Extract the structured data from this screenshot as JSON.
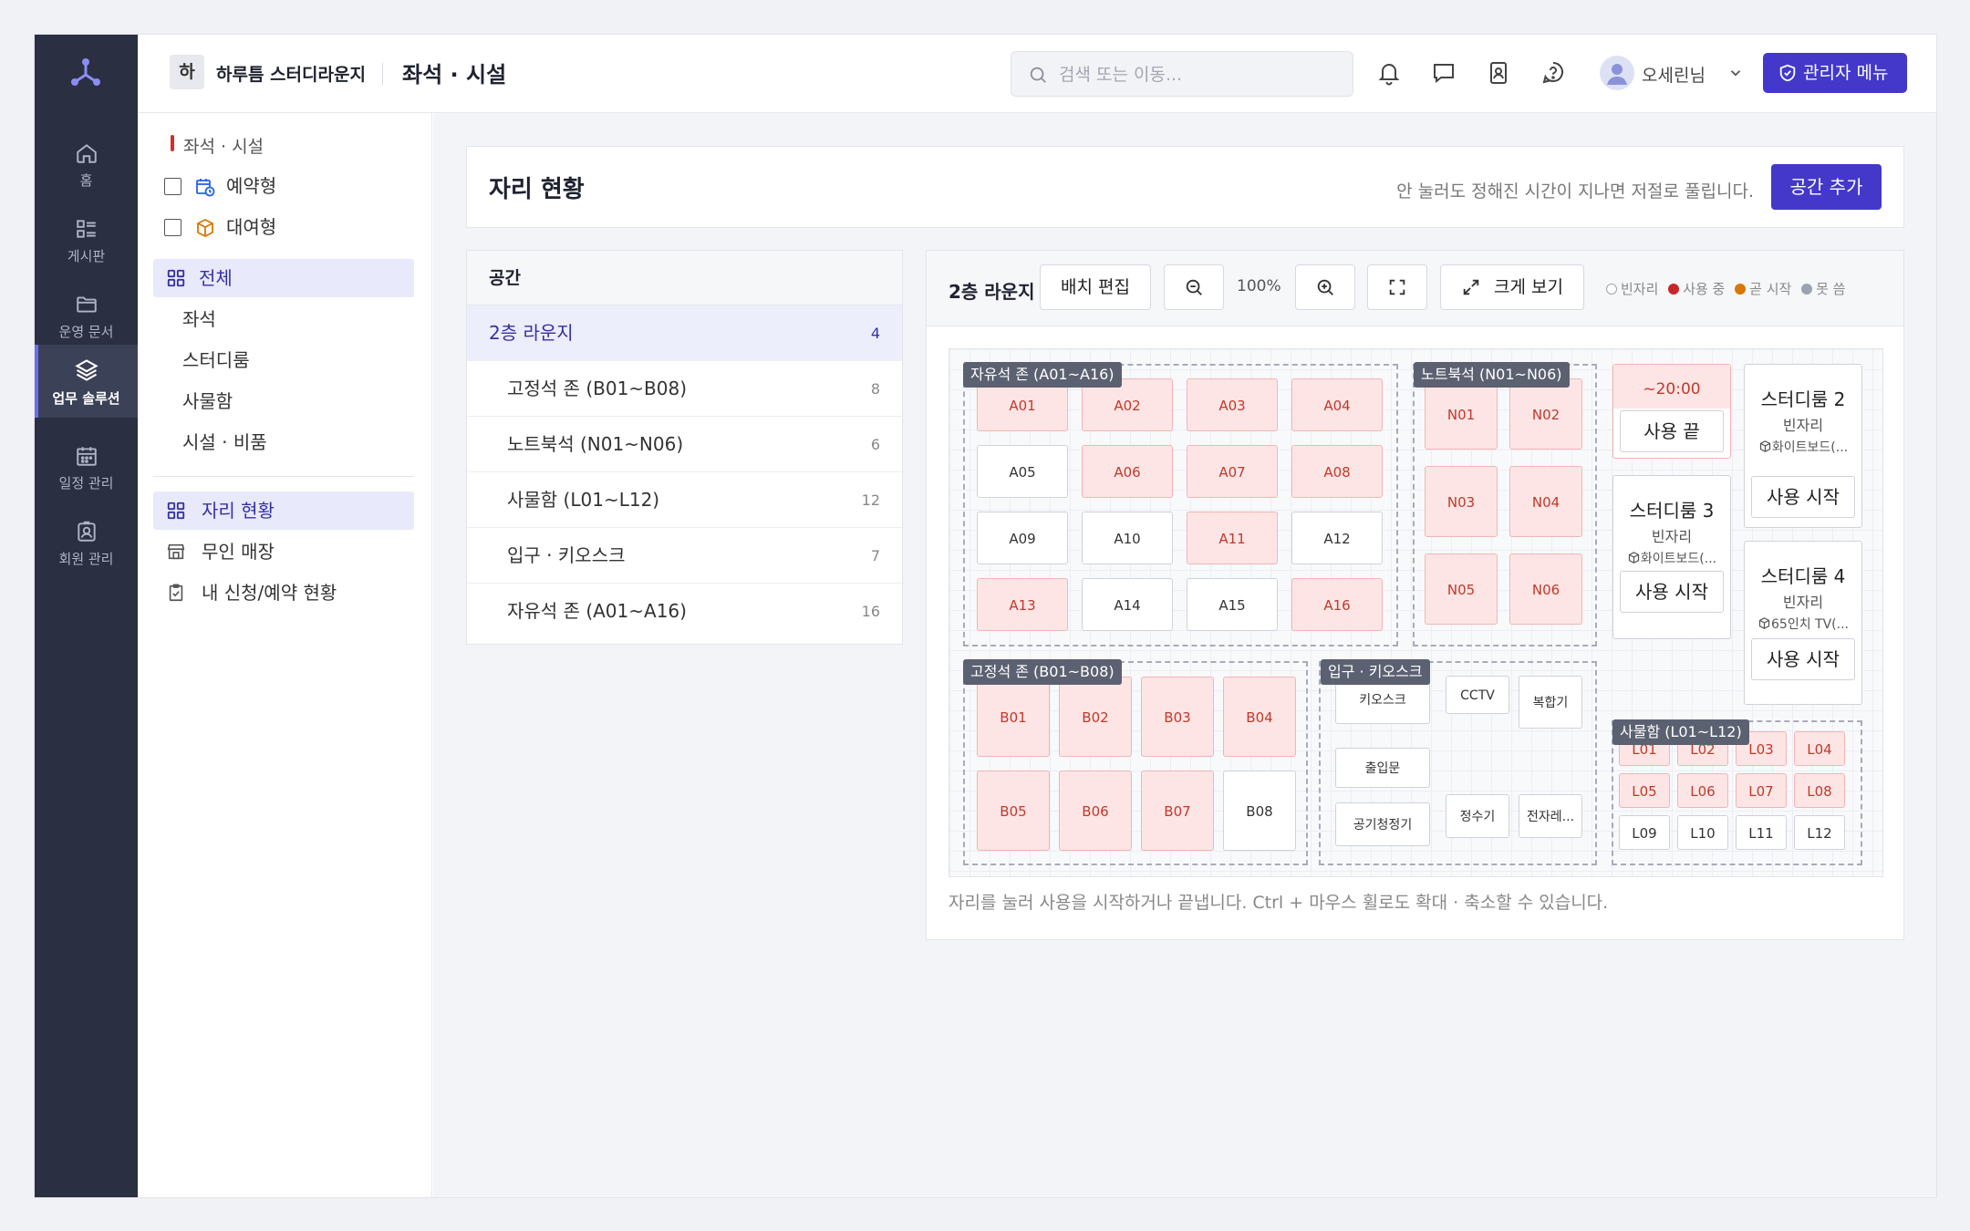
{
  "rail": {
    "items": [
      {
        "label": "홈",
        "icon": "home-icon"
      },
      {
        "label": "게시판",
        "icon": "board-icon"
      },
      {
        "label": "운영 문서",
        "icon": "folder-icon"
      },
      {
        "label": "업무 솔루션",
        "icon": "layers-icon",
        "active": true
      },
      {
        "label": "일정 관리",
        "icon": "calendar-icon"
      },
      {
        "label": "회원 관리",
        "icon": "member-icon"
      }
    ]
  },
  "topbar": {
    "org_badge": "하",
    "org_name": "하루틈 스터디라운지",
    "page_title": "좌석 · 시설",
    "search_placeholder": "검색 또는 이동...",
    "user_name": "오세린님",
    "admin_label": "관리자 메뉴"
  },
  "sidebar": {
    "section": "좌석 · 시설",
    "filters": [
      {
        "label": "예약형",
        "icon": "calendar-clock-icon",
        "checked": false
      },
      {
        "label": "대여형",
        "icon": "box-icon",
        "checked": false
      }
    ],
    "categories": [
      {
        "label": "전체",
        "active": true
      },
      {
        "label": "좌석"
      },
      {
        "label": "스터디룸"
      },
      {
        "label": "사물함"
      },
      {
        "label": "시설 · 비품"
      }
    ],
    "links": [
      {
        "label": "자리 현황",
        "active": true
      },
      {
        "label": "무인 매장"
      },
      {
        "label": "내 신청/예약 현황"
      }
    ]
  },
  "header": {
    "title": "자리 현황",
    "hint": "안 눌러도 정해진 시간이 지나면 저절로 풀립니다.",
    "add_label": "공간 추가"
  },
  "spaces": {
    "title": "공간",
    "rows": [
      {
        "name": "2층 라운지",
        "count": "4",
        "active": true
      },
      {
        "name": "고정석 존 (B01~B08)",
        "count": "8"
      },
      {
        "name": "노트북석 (N01~N06)",
        "count": "6"
      },
      {
        "name": "사물함 (L01~L12)",
        "count": "12"
      },
      {
        "name": "입구 · 키오스크",
        "count": "7"
      },
      {
        "name": "자유석 존 (A01~A16)",
        "count": "16"
      }
    ]
  },
  "map": {
    "title": "2층 라운지",
    "edit_label": "배치 편집",
    "zoom": "100%",
    "expand_label": "크게 보기",
    "legend": [
      {
        "label": "빈자리",
        "color": "#ffffff"
      },
      {
        "label": "사용 중",
        "color": "#c62828"
      },
      {
        "label": "곧 시작",
        "color": "#d97706"
      },
      {
        "label": "못 씀",
        "color": "#9ca3af"
      }
    ],
    "zones": {
      "free": "자유석 존 (A01~A16)",
      "notebook": "노트북석 (N01~N06)",
      "fixed": "고정석 존 (B01~B08)",
      "entrance": "입구 · 키오스크",
      "locker": "사물함 (L01~L12)"
    },
    "free_seats": [
      {
        "id": "A01",
        "busy": true
      },
      {
        "id": "A02",
        "busy": true
      },
      {
        "id": "A03",
        "busy": true
      },
      {
        "id": "A04",
        "busy": true
      },
      {
        "id": "A05",
        "busy": false
      },
      {
        "id": "A06",
        "busy": true
      },
      {
        "id": "A07",
        "busy": true
      },
      {
        "id": "A08",
        "busy": true
      },
      {
        "id": "A09",
        "busy": false
      },
      {
        "id": "A10",
        "busy": false
      },
      {
        "id": "A11",
        "busy": true
      },
      {
        "id": "A12",
        "busy": false
      },
      {
        "id": "A13",
        "busy": true
      },
      {
        "id": "A14",
        "busy": false
      },
      {
        "id": "A15",
        "busy": false
      },
      {
        "id": "A16",
        "busy": true
      }
    ],
    "notebook_seats": [
      {
        "id": "N01",
        "busy": true
      },
      {
        "id": "N02",
        "busy": true
      },
      {
        "id": "N03",
        "busy": true
      },
      {
        "id": "N04",
        "busy": true
      },
      {
        "id": "N05",
        "busy": true
      },
      {
        "id": "N06",
        "busy": true
      }
    ],
    "fixed_seats": [
      {
        "id": "B01",
        "busy": true
      },
      {
        "id": "B02",
        "busy": true
      },
      {
        "id": "B03",
        "busy": true
      },
      {
        "id": "B04",
        "busy": true
      },
      {
        "id": "B05",
        "busy": true
      },
      {
        "id": "B06",
        "busy": true
      },
      {
        "id": "B07",
        "busy": true
      },
      {
        "id": "B08",
        "busy": false
      }
    ],
    "entrance_items": [
      "키오스크",
      "CCTV",
      "복합기",
      "출입문",
      "공기청정기",
      "정수기",
      "전자레..."
    ],
    "lockers": [
      {
        "id": "L01",
        "busy": true
      },
      {
        "id": "L02",
        "busy": true
      },
      {
        "id": "L03",
        "busy": true
      },
      {
        "id": "L04",
        "busy": true
      },
      {
        "id": "L05",
        "busy": true
      },
      {
        "id": "L06",
        "busy": true
      },
      {
        "id": "L07",
        "busy": true
      },
      {
        "id": "L08",
        "busy": true
      },
      {
        "id": "L09",
        "busy": false
      },
      {
        "id": "L10",
        "busy": false
      },
      {
        "id": "L11",
        "busy": false
      },
      {
        "id": "L12",
        "busy": false
      }
    ],
    "rooms": {
      "room1": {
        "time": "~20:00",
        "button": "사용 끝"
      },
      "room2": {
        "name": "스터디룸 2",
        "status": "빈자리",
        "facility": "화이트보드(...",
        "button": "사용 시작"
      },
      "room3": {
        "name": "스터디룸 3",
        "status": "빈자리",
        "facility": "화이트보드(...",
        "button": "사용 시작"
      },
      "room4": {
        "name": "스터디룸 4",
        "status": "빈자리",
        "facility": "65인치 TV(...",
        "button": "사용 시작"
      }
    },
    "footer": "자리를 눌러 사용을 시작하거나 끝냅니다. Ctrl + 마우스 휠로도 확대 · 축소할 수 있습니다."
  }
}
